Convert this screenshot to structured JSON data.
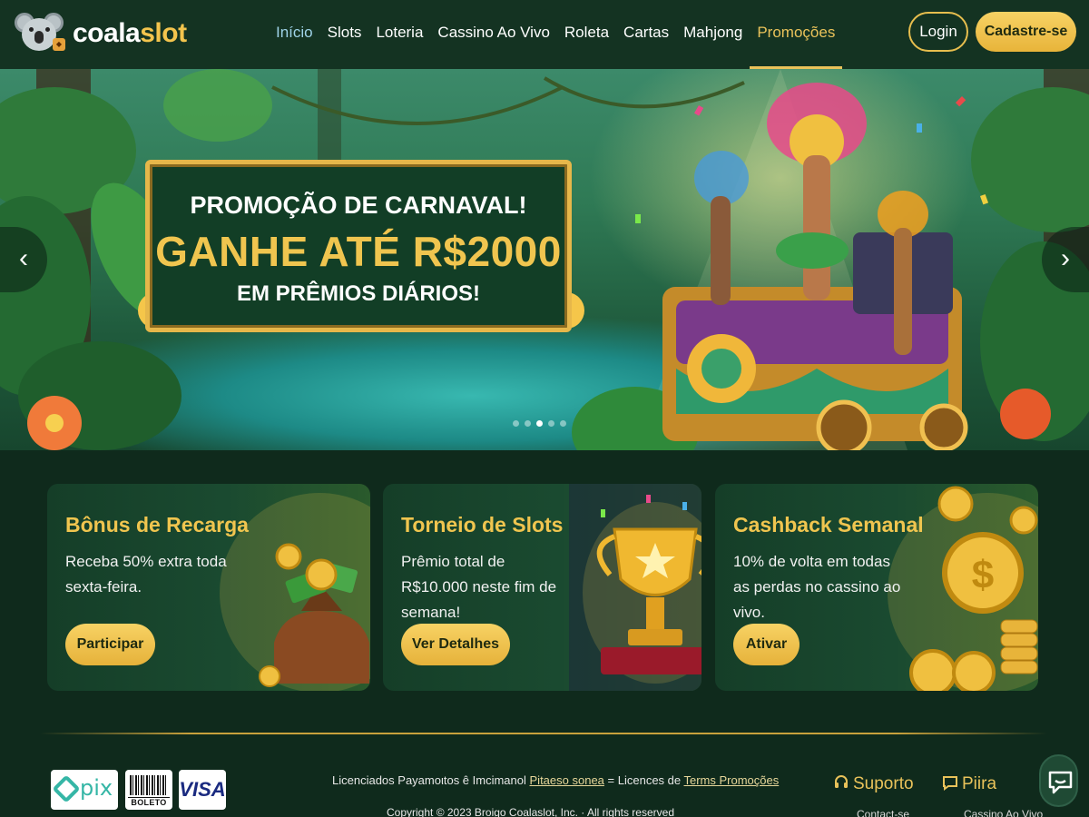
{
  "brand": {
    "name_part1": "coala",
    "name_part2": "slot"
  },
  "nav": {
    "items": [
      {
        "label": "Início"
      },
      {
        "label": "Slots"
      },
      {
        "label": "Loteria"
      },
      {
        "label": "Cassino Ao Vivo"
      },
      {
        "label": "Roleta"
      },
      {
        "label": "Cartas"
      },
      {
        "label": "Mahjong"
      },
      {
        "label": "Promoções"
      }
    ],
    "active": "Promoções"
  },
  "auth": {
    "login_label": "Login",
    "signup_label": "Cadastre-se"
  },
  "hero": {
    "line1": "PROMOÇÃO DE CARNAVAL!",
    "line2": "GANHE ATÉ R$2000",
    "line3": "EM PRÊMIOS DIÁRIOS!",
    "prev_glyph": "‹",
    "next_glyph": "›",
    "slide_count": 5,
    "active_slide": 3
  },
  "cards": [
    {
      "title": "Bônus de Recarga",
      "desc": "Receba 50% extra toda sexta-feira.",
      "button": "Participar",
      "icon": "money-bag-icon"
    },
    {
      "title": "Torneio de Slots",
      "desc": "Prêmio total de R$10.000 neste fim de semana!",
      "button": "Ver Detalhes",
      "icon": "trophy-icon"
    },
    {
      "title": "Cashback Semanal",
      "desc": "10% de volta em todas as perdas no cassino ao vivo.",
      "button": "Ativar",
      "icon": "gold-coins-icon"
    }
  ],
  "footer": {
    "payments": {
      "pix": "pix",
      "boleto": "BOLETO",
      "visa": "VISA"
    },
    "text_before": "Licenciados Payamoιtos ê Imcimanol",
    "link1": "Pitaeso sonea",
    "text_middle": " = Licences de ",
    "link2": "Terms Promoções",
    "copyright": "Copyright © 2023 Broigo Coalaslot, Inc. · All rights reserved",
    "support_label": "Suporto",
    "piira_label": "Piira",
    "sub1": "Contact-se",
    "sub2": "Cassino Ao Vivo"
  },
  "colors": {
    "accent": "#f0c54f",
    "background": "#0f2a1c",
    "header": "#143322"
  }
}
